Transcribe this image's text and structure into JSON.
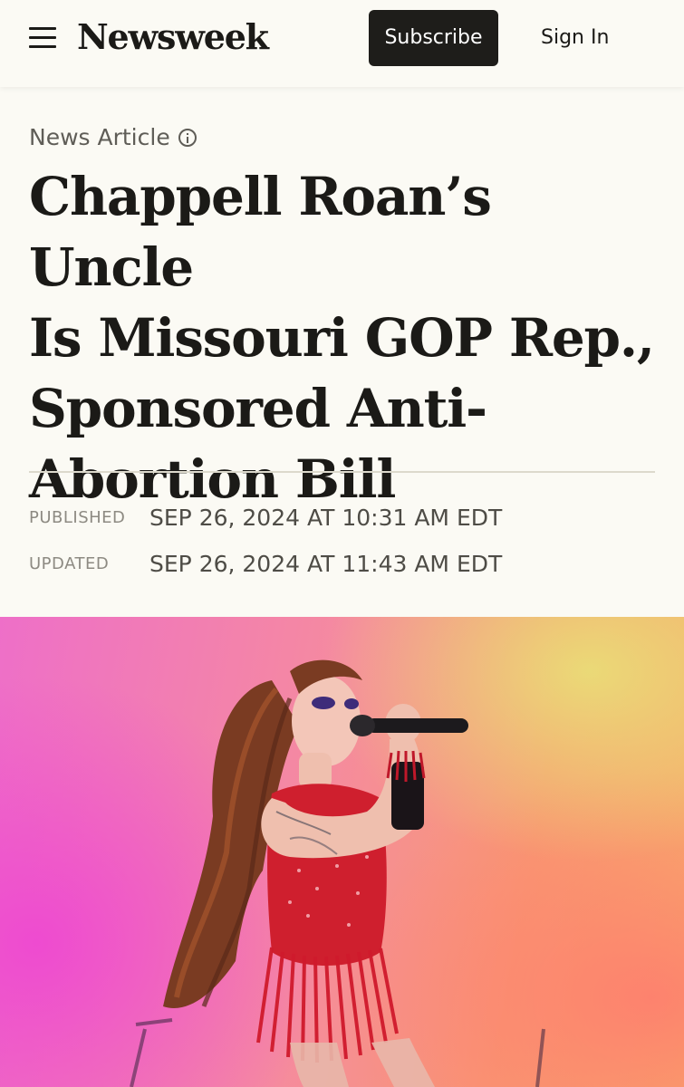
{
  "header": {
    "logo": "Newsweek",
    "subscribe_label": "Subscribe",
    "signin_label": "Sign In",
    "menu_icon": "hamburger-menu-icon"
  },
  "article": {
    "kicker": "News Article",
    "kicker_icon": "info-icon",
    "headline_lines": [
      "Chappell Roan’s Uncle",
      "Is Missouri GOP Rep.,",
      "Sponsored Anti-",
      "Abortion Bill"
    ],
    "meta": {
      "published_label": "PUBLISHED",
      "published_value": "SEP 26, 2024 AT 10:31 AM EDT",
      "updated_label": "UPDATED",
      "updated_value": "SEP 26, 2024 AT 11:43 AM EDT"
    }
  },
  "colors": {
    "background": "#fbfaf4",
    "text": "#1b1a17",
    "button_bg": "#1e1d1a",
    "muted": "#8d8a82",
    "divider": "#dcd9cc"
  }
}
